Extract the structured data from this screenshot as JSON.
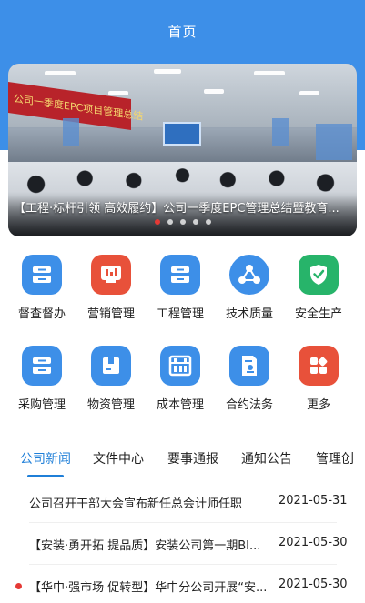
{
  "header": {
    "title": "首页"
  },
  "banner": {
    "sign_text": "公司一季度EPC项目管理总结",
    "caption": "【工程·标杆引领 高效履约】公司一季度EPC管理总结暨教育...",
    "dots_count": 5,
    "active_dot": 0
  },
  "grid": [
    {
      "label": "督查督办",
      "icon": "stack-icon",
      "color": "#3d8fe8"
    },
    {
      "label": "营销管理",
      "icon": "chart-badge-icon",
      "color": "#e8513a"
    },
    {
      "label": "工程管理",
      "icon": "stack-icon",
      "color": "#3d8fe8"
    },
    {
      "label": "技术质量",
      "icon": "share-icon",
      "color": "#3d8fe8"
    },
    {
      "label": "安全生产",
      "icon": "shield-check-icon",
      "color": "#27b46a"
    },
    {
      "label": "采购管理",
      "icon": "stack-icon",
      "color": "#3d8fe8"
    },
    {
      "label": "物资管理",
      "icon": "box-icon",
      "color": "#3d8fe8"
    },
    {
      "label": "成本管理",
      "icon": "abacus-icon",
      "color": "#3d8fe8"
    },
    {
      "label": "合约法务",
      "icon": "document-seal-icon",
      "color": "#3d8fe8"
    },
    {
      "label": "更多",
      "icon": "grid-more-icon",
      "color": "#e8513a"
    }
  ],
  "tabs": [
    {
      "label": "公司新闻",
      "active": true
    },
    {
      "label": "文件中心",
      "active": false
    },
    {
      "label": "要事通报",
      "active": false
    },
    {
      "label": "通知公告",
      "active": false
    },
    {
      "label": "管理创",
      "active": false
    }
  ],
  "news": [
    {
      "title": "公司召开干部大会宣布新任总会计师任职",
      "date": "2021-05-31",
      "unread": false
    },
    {
      "title": "【安装·勇开拓 提品质】安装公司第一期BI...",
      "date": "2021-05-30",
      "unread": false
    },
    {
      "title": "【华中·强市场 促转型】华中分公司开展“安...",
      "date": "2021-05-30",
      "unread": true
    }
  ],
  "colors": {
    "primary": "#3d8fe8",
    "accent_red": "#e53935",
    "tab_active": "#1f7fd8",
    "green": "#27b46a"
  }
}
